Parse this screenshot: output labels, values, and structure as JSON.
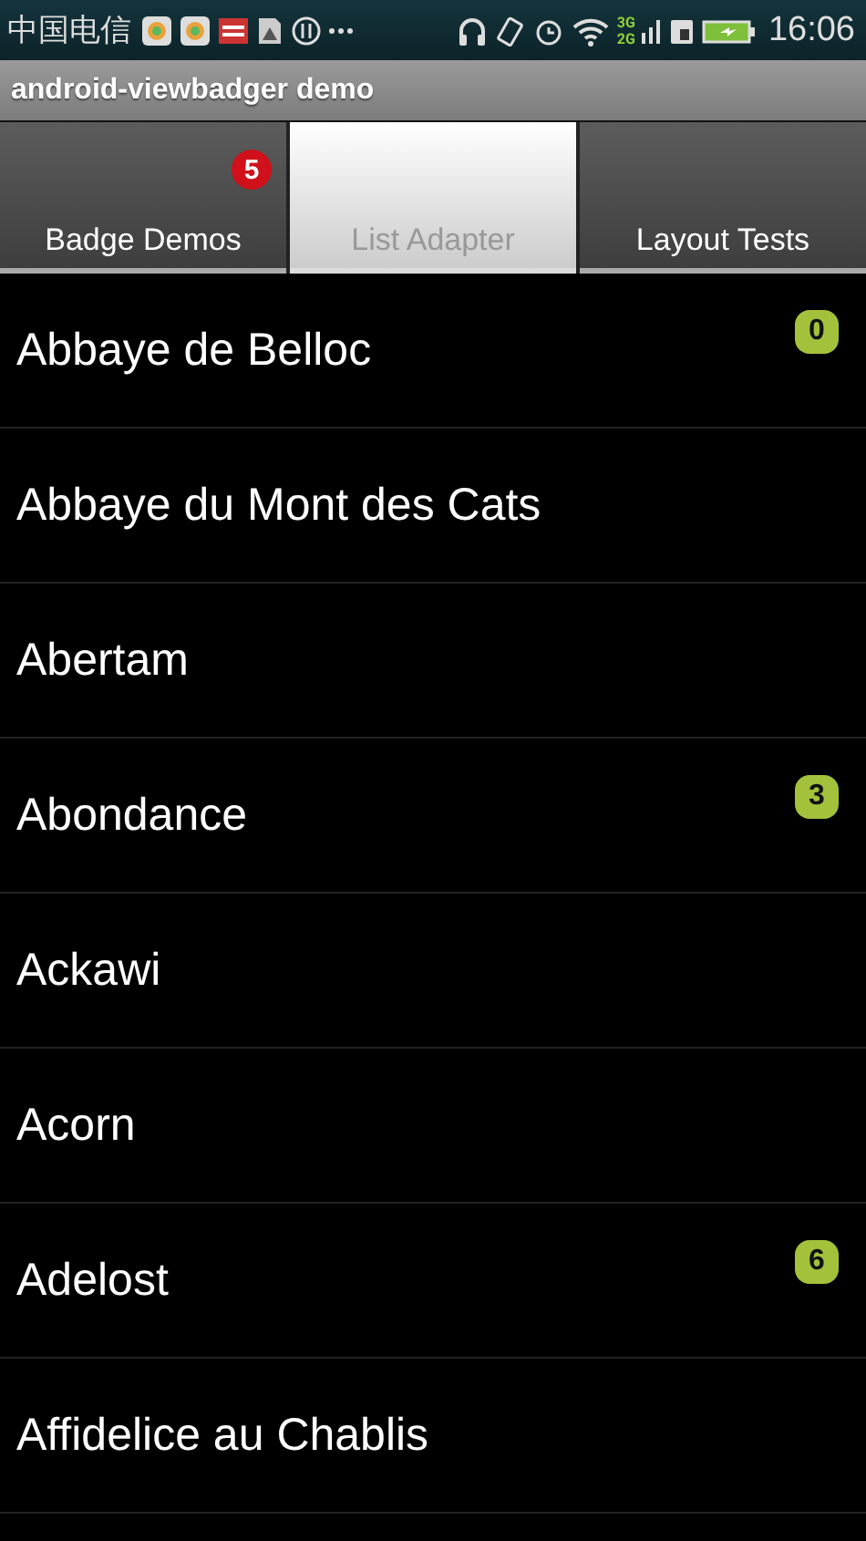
{
  "status_bar": {
    "carrier": "中国电信",
    "network": "3G",
    "network_2": "2G",
    "time": "16:06"
  },
  "window": {
    "title": "android-viewbadger demo"
  },
  "tabs": [
    {
      "label": "Badge Demos",
      "selected": false,
      "badge": "5"
    },
    {
      "label": "List Adapter",
      "selected": true
    },
    {
      "label": "Layout Tests",
      "selected": false
    }
  ],
  "list": [
    {
      "name": "Abbaye de Belloc",
      "badge": "0"
    },
    {
      "name": "Abbaye du Mont des Cats"
    },
    {
      "name": "Abertam"
    },
    {
      "name": "Abondance",
      "badge": "3"
    },
    {
      "name": "Ackawi"
    },
    {
      "name": "Acorn"
    },
    {
      "name": "Adelost",
      "badge": "6"
    },
    {
      "name": "Affidelice au Chablis"
    }
  ]
}
